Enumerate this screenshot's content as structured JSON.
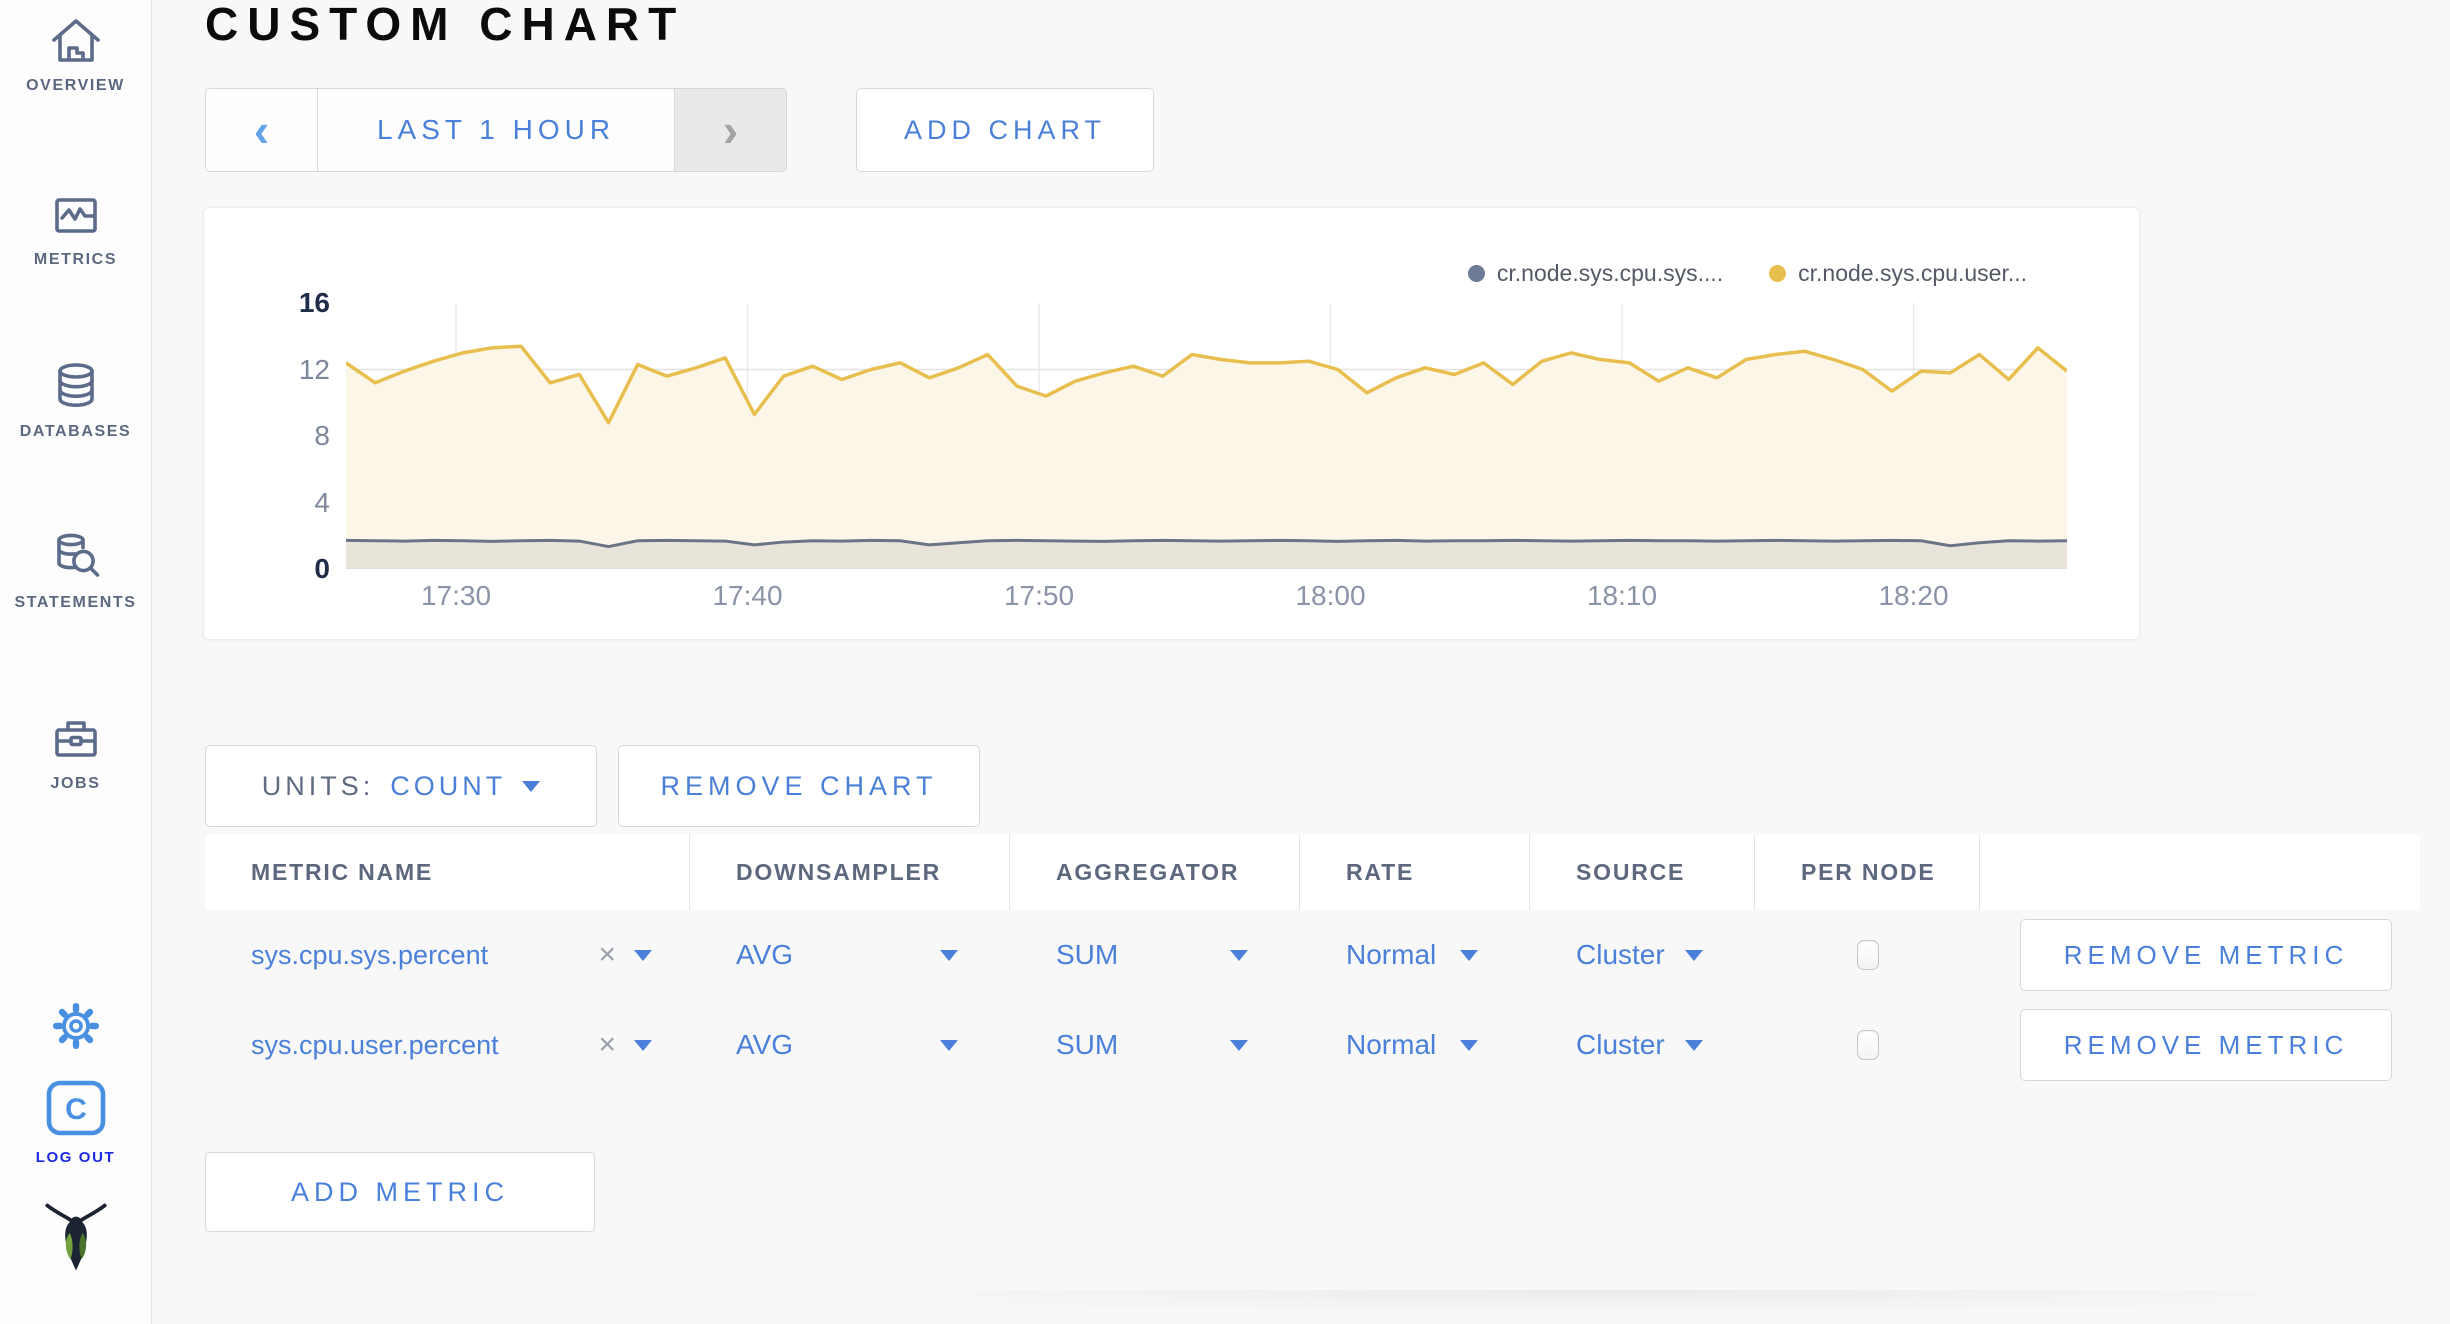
{
  "sidebar": {
    "items": [
      {
        "id": "overview",
        "label": "OVERVIEW"
      },
      {
        "id": "metrics",
        "label": "METRICS"
      },
      {
        "id": "databases",
        "label": "DATABASES"
      },
      {
        "id": "statements",
        "label": "STATEMENTS"
      },
      {
        "id": "jobs",
        "label": "JOBS"
      }
    ],
    "logout_label": "LOG OUT"
  },
  "page": {
    "title": "CUSTOM CHART"
  },
  "controls": {
    "prev_arrow": "‹",
    "range_label": "LAST 1 HOUR",
    "next_arrow": "›",
    "add_chart": "ADD CHART"
  },
  "units_bar": {
    "units_label": "UNITS:",
    "units_value": "COUNT",
    "remove_chart": "REMOVE CHART"
  },
  "chart_data": {
    "type": "area",
    "title": "",
    "xlabel": "",
    "ylabel": "",
    "ylim": [
      0,
      16
    ],
    "y_ticks": [
      16,
      12,
      8,
      4,
      0
    ],
    "x_ticks": [
      "17:30",
      "17:40",
      "17:50",
      "18:00",
      "18:10",
      "18:20"
    ],
    "x_range": [
      "17:26",
      "18:25"
    ],
    "grid": true,
    "legend_position": "top-right",
    "legend": [
      {
        "label": "cr.node.sys.cpu.sys....",
        "color": "#6d7b96"
      },
      {
        "label": "cr.node.sys.cpu.user...",
        "color": "#e8bf4e"
      }
    ],
    "series": [
      {
        "name": "cr.node.sys.cpu.sys.percent",
        "color": "#6b7487",
        "fill": "#e9e4da",
        "values": [
          1.72,
          1.7,
          1.68,
          1.72,
          1.7,
          1.66,
          1.7,
          1.72,
          1.68,
          1.35,
          1.7,
          1.72,
          1.7,
          1.68,
          1.45,
          1.62,
          1.7,
          1.68,
          1.72,
          1.7,
          1.45,
          1.58,
          1.7,
          1.72,
          1.7,
          1.68,
          1.66,
          1.7,
          1.72,
          1.7,
          1.68,
          1.7,
          1.72,
          1.7,
          1.66,
          1.7,
          1.72,
          1.68,
          1.7,
          1.7,
          1.72,
          1.7,
          1.68,
          1.7,
          1.72,
          1.7,
          1.7,
          1.68,
          1.7,
          1.72,
          1.7,
          1.68,
          1.7,
          1.72,
          1.7,
          1.4,
          1.58,
          1.7,
          1.68,
          1.7
        ]
      },
      {
        "name": "cr.node.sys.cpu.user.percent",
        "color": "#e8bf4e",
        "fill": "#fbf6e8",
        "values": [
          12.4,
          11.2,
          11.9,
          12.5,
          13.0,
          13.3,
          13.4,
          11.2,
          11.7,
          8.8,
          12.3,
          11.6,
          12.1,
          12.7,
          9.3,
          11.6,
          12.2,
          11.4,
          12.0,
          12.4,
          11.5,
          12.1,
          12.9,
          11.0,
          10.4,
          11.3,
          11.8,
          12.2,
          11.6,
          12.9,
          12.6,
          12.4,
          12.4,
          12.5,
          12.0,
          10.6,
          11.5,
          12.1,
          11.7,
          12.4,
          11.1,
          12.5,
          13.0,
          12.6,
          12.4,
          11.3,
          12.1,
          11.5,
          12.6,
          12.9,
          13.1,
          12.6,
          12.0,
          10.7,
          11.9,
          11.8,
          12.9,
          11.4,
          13.3,
          11.9
        ]
      }
    ]
  },
  "table": {
    "columns": [
      "METRIC NAME",
      "DOWNSAMPLER",
      "AGGREGATOR",
      "RATE",
      "SOURCE",
      "PER NODE",
      ""
    ],
    "rows": [
      {
        "name": "sys.cpu.sys.percent",
        "clear": "×",
        "downsampler": "AVG",
        "aggregator": "SUM",
        "rate": "Normal",
        "source": "Cluster",
        "per_node_checked": false,
        "remove_label": "REMOVE METRIC"
      },
      {
        "name": "sys.cpu.user.percent",
        "clear": "×",
        "downsampler": "AVG",
        "aggregator": "SUM",
        "rate": "Normal",
        "source": "Cluster",
        "per_node_checked": false,
        "remove_label": "REMOVE METRIC"
      }
    ]
  },
  "add_metric_label": "ADD METRIC",
  "colors": {
    "accent_blue": "#4a80da",
    "logout_blue": "#1d2ae2",
    "sidebar_slate": "#5c6880",
    "series_yellow": "#e8bf4e",
    "series_gray": "#6b7487",
    "page_bg": "#f8f8f8"
  }
}
